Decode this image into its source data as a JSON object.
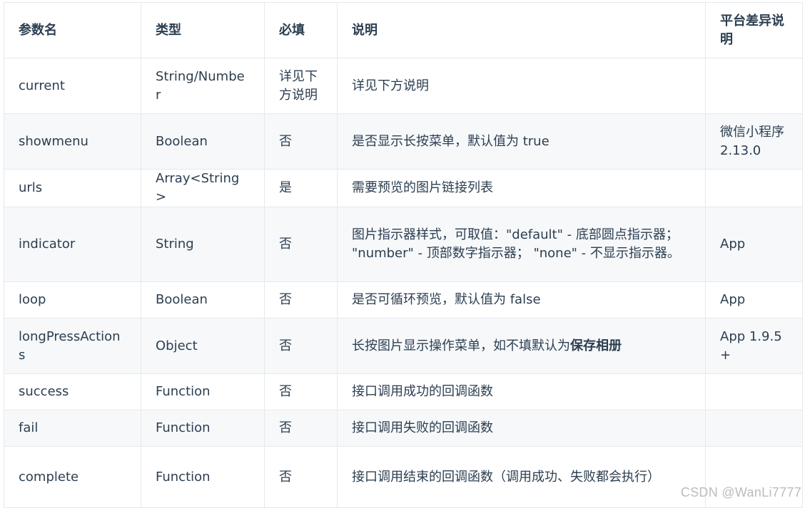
{
  "table": {
    "headers": {
      "name": "参数名",
      "type": "类型",
      "required": "必填",
      "description": "说明",
      "platform": "平台差异说明"
    },
    "rows": [
      {
        "name": "current",
        "type": "String/Number",
        "required": "详见下方说明",
        "description": "详见下方说明",
        "description_strong": "",
        "platform": ""
      },
      {
        "name": "showmenu",
        "type": "Boolean",
        "required": "否",
        "description": "是否显示长按菜单，默认值为 true",
        "description_strong": "",
        "platform": "微信小程序2.13.0"
      },
      {
        "name": "urls",
        "type": "Array<String>",
        "required": "是",
        "description": "需要预览的图片链接列表",
        "description_strong": "",
        "platform": ""
      },
      {
        "name": "indicator",
        "type": "String",
        "required": "否",
        "description": "图片指示器样式，可取值：\"default\" - 底部圆点指示器； \"number\" - 顶部数字指示器； \"none\" - 不显示指示器。",
        "description_strong": "",
        "platform": "App"
      },
      {
        "name": "loop",
        "type": "Boolean",
        "required": "否",
        "description": "是否可循环预览，默认值为 false",
        "description_strong": "",
        "platform": "App"
      },
      {
        "name": "longPressActions",
        "type": "Object",
        "required": "否",
        "description": "长按图片显示操作菜单，如不填默认为",
        "description_strong": "保存相册",
        "platform": "App 1.9.5+"
      },
      {
        "name": "success",
        "type": "Function",
        "required": "否",
        "description": "接口调用成功的回调函数",
        "description_strong": "",
        "platform": ""
      },
      {
        "name": "fail",
        "type": "Function",
        "required": "否",
        "description": "接口调用失败的回调函数",
        "description_strong": "",
        "platform": ""
      },
      {
        "name": "complete",
        "type": "Function",
        "required": "否",
        "description": "接口调用结束的回调函数（调用成功、失败都会执行）",
        "description_strong": "",
        "platform": ""
      }
    ]
  },
  "watermark": "CSDN @WanLi7777"
}
